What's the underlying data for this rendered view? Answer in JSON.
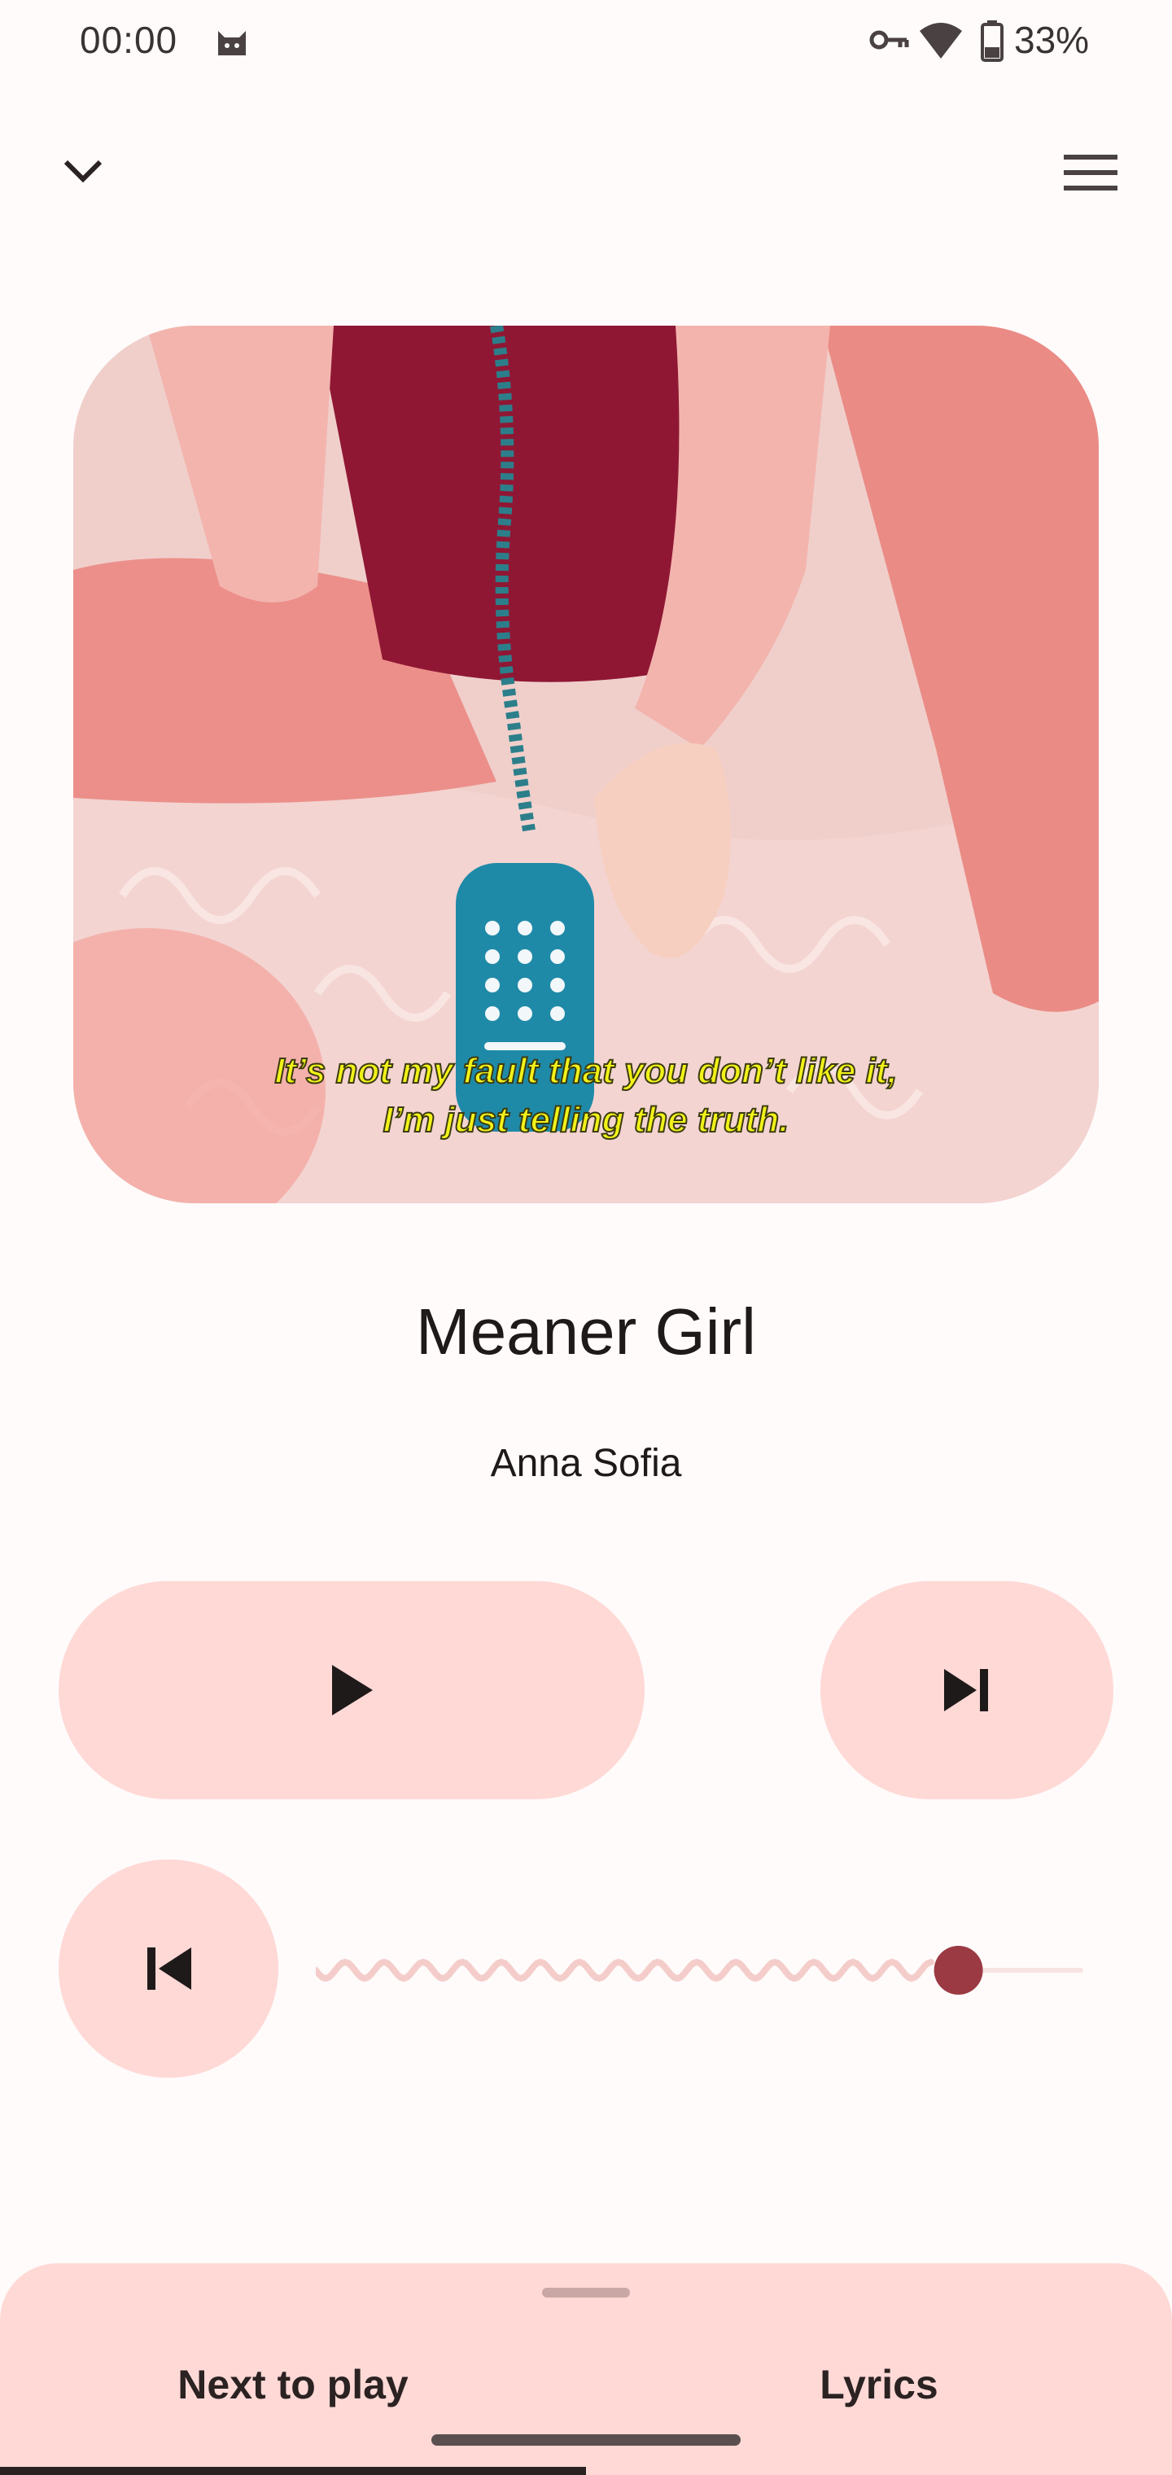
{
  "status_bar": {
    "time": "00:00",
    "battery": "33%",
    "icons": [
      "cat-icon",
      "key-icon",
      "wifi-icon",
      "battery-icon"
    ]
  },
  "app_bar": {
    "left_icon": "chevron-down-icon",
    "right_icon": "menu-icon"
  },
  "album_art": {
    "caption_line1": "It’s not my fault that you don’t like it,",
    "caption_line2": "I’m just telling the truth."
  },
  "track": {
    "title": "Meaner Girl",
    "artist": "Anna Sofia"
  },
  "controls": {
    "play_icon": "play-icon",
    "next_icon": "skip-next-icon",
    "previous_icon": "skip-previous-icon"
  },
  "progress": {
    "fraction": 0.84
  },
  "bottom_sheet": {
    "tabs": [
      {
        "label": "Next to play",
        "selected": true
      },
      {
        "label": "Lyrics",
        "selected": false
      }
    ]
  },
  "colors": {
    "accent": "#9b3a43",
    "button_bg": "#ffd9d6",
    "background": "#fffbfb",
    "caption_yellow": "#f2f21a"
  }
}
